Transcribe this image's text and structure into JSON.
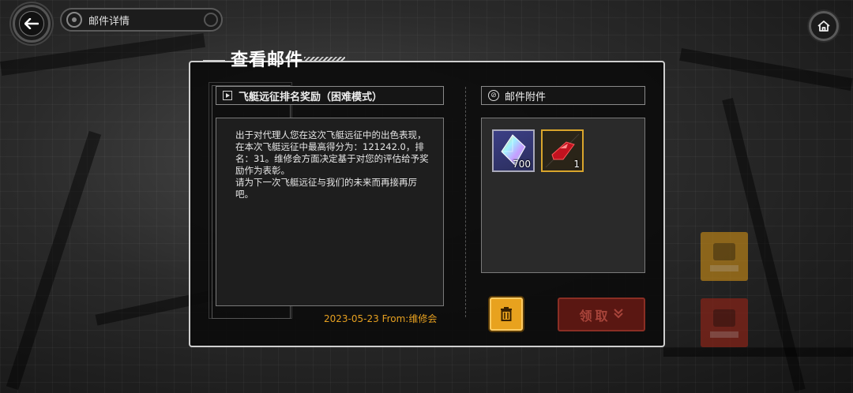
{
  "header": {
    "title": "邮件详情",
    "back_icon": "back-arrow-icon",
    "home_icon": "home-icon"
  },
  "panel": {
    "title": "查看邮件"
  },
  "mail": {
    "subject": "飞艇远征排名奖励（困难模式）",
    "body": "出于对代理人您在这次飞艇远征中的出色表现，在本次飞艇远征中最高得分为：121242.0，排名：31。维修会方面决定基于对您的评估给予奖励作为表彰。\n请为下一次飞艇远征与我们的未来而再接再厉吧。",
    "date": "2023-05-23",
    "from": "From:维修会"
  },
  "attachments": {
    "header": "邮件附件",
    "items": [
      {
        "icon": "crystal-gem-icon",
        "count": "700"
      },
      {
        "icon": "red-crystal-icon",
        "count": "1"
      }
    ]
  },
  "actions": {
    "delete_icon": "trash-icon",
    "claim_label": "领取",
    "claim_icon": "double-chevron-down-icon"
  },
  "colors": {
    "accent_orange": "#e8a21e",
    "claim_red": "#5a1712",
    "date_text": "#e6a020"
  }
}
